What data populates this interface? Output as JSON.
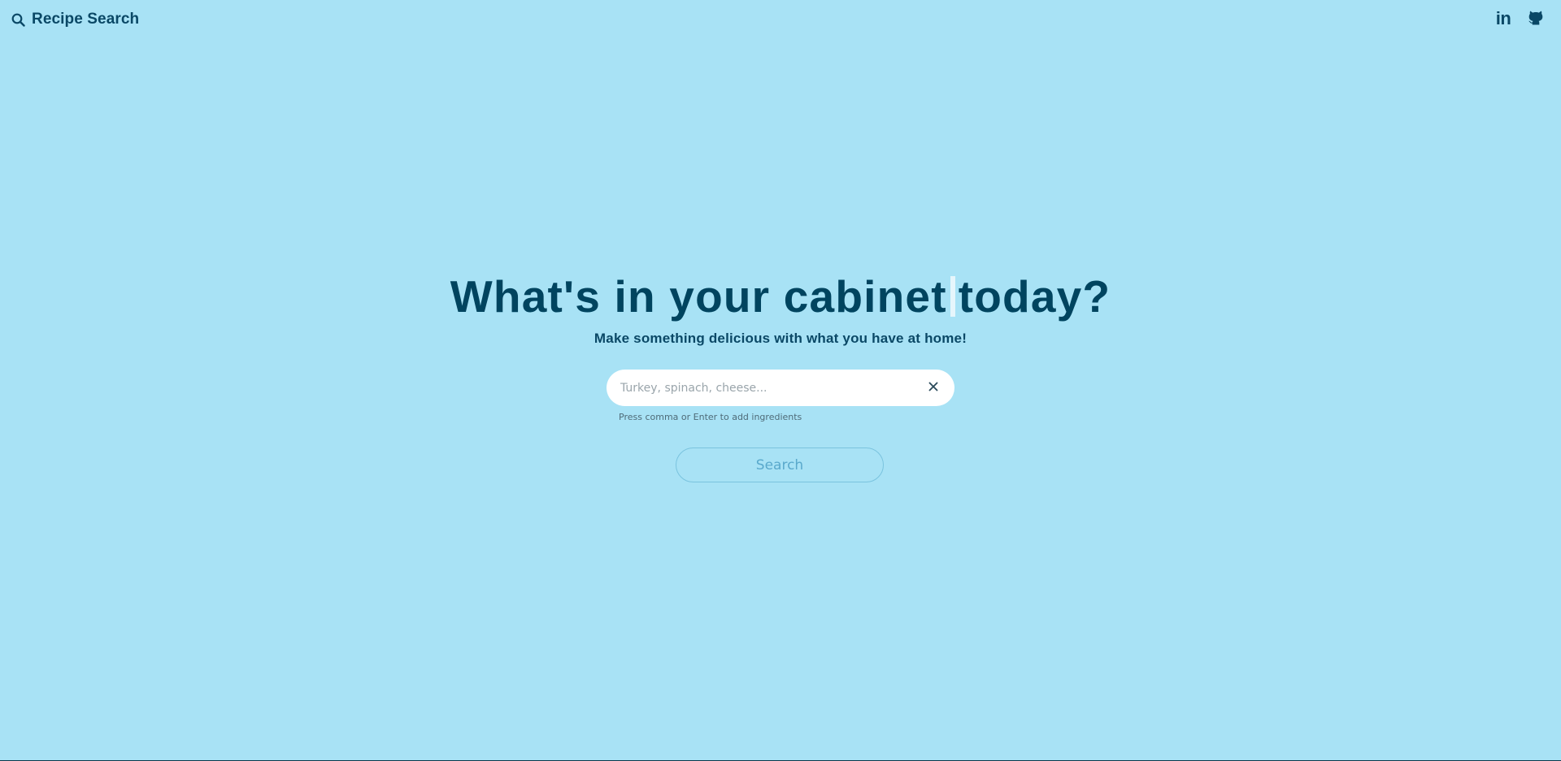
{
  "header": {
    "brand_icon": "search-icon",
    "brand_title": "Recipe Search",
    "social": [
      {
        "name": "linkedin-icon",
        "label": "in"
      },
      {
        "name": "github-icon",
        "label": ""
      }
    ]
  },
  "hero": {
    "headline_before_caret": "What's in your cabinet",
    "headline_after_caret": "today?",
    "subheadline": "Make something delicious with what you have at home!"
  },
  "search": {
    "value": "",
    "placeholder": "Turkey, spinach, cheese...",
    "clear_icon": "close-icon",
    "hint": "Press comma or Enter to add ingredients",
    "button_label": "Search"
  },
  "colors": {
    "background": "#a8e2f5",
    "text_dark": "#00445f",
    "button_text": "#5aa9cc",
    "button_border": "#7ac3de",
    "input_bg": "#ffffff"
  }
}
